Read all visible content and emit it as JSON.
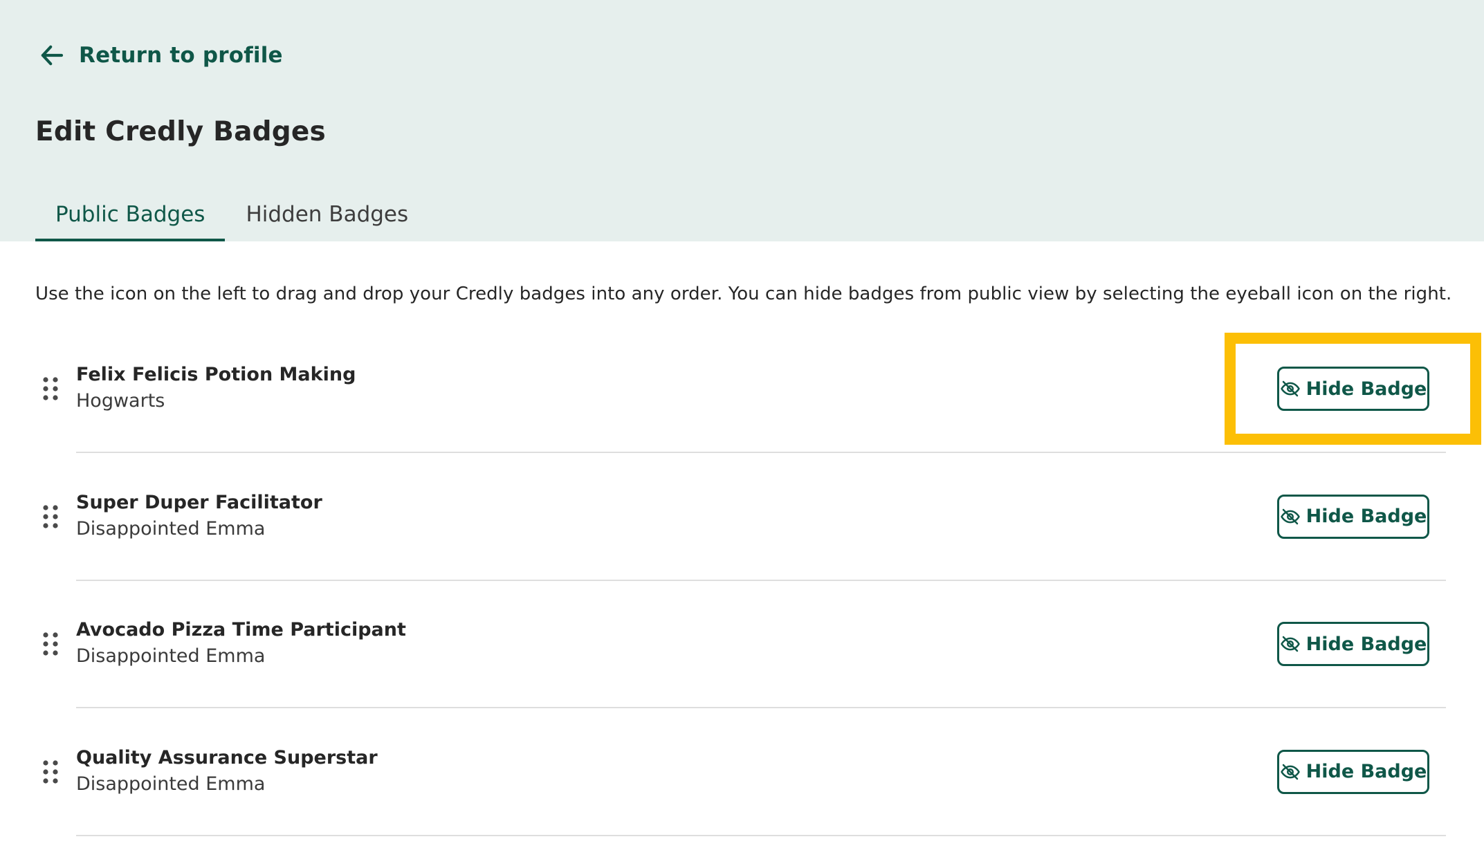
{
  "header": {
    "back_link_label": "Return to profile",
    "page_title": "Edit Credly Badges",
    "tabs": [
      {
        "label": "Public Badges",
        "active": true
      },
      {
        "label": "Hidden Badges",
        "active": false
      }
    ]
  },
  "instructions": "Use the icon on the left to drag and drop your Credly badges into any order. You can hide badges from public view by selecting the eyeball icon on the right.",
  "badges": [
    {
      "name": "Felix Felicis Potion Making",
      "issuer": "Hogwarts",
      "action_label": "Hide Badge"
    },
    {
      "name": "Super Duper Facilitator",
      "issuer": "Disappointed Emma",
      "action_label": "Hide Badge"
    },
    {
      "name": "Avocado Pizza Time Participant",
      "issuer": "Disappointed Emma",
      "action_label": "Hide Badge"
    },
    {
      "name": "Quality Assurance Superstar",
      "issuer": "Disappointed Emma",
      "action_label": "Hide Badge"
    }
  ],
  "icons": {
    "back": "arrow-left-icon",
    "drag": "drag-handle-icon",
    "hide": "eye-slash-icon"
  },
  "colors": {
    "header_bg": "#e6efed",
    "brand_green": "#0f5748",
    "highlight": "#fcbf06",
    "divider": "#dedede"
  },
  "annotation": {
    "highlighted_badge_index": 0
  }
}
